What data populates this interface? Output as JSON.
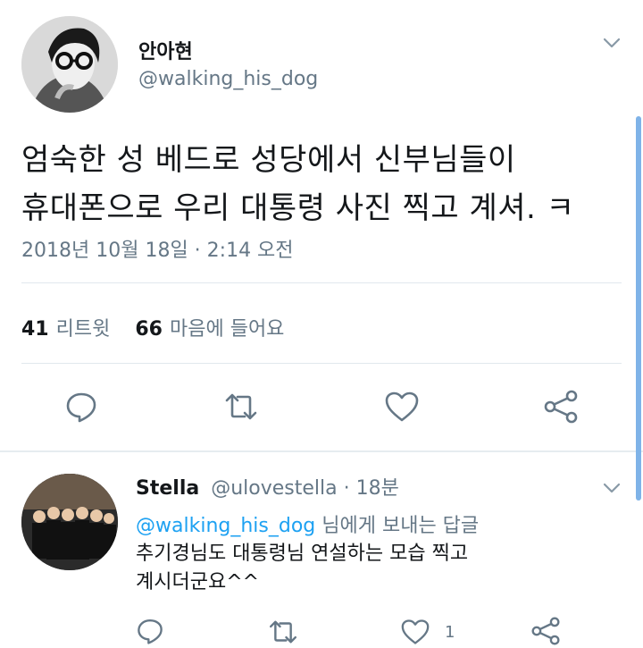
{
  "tweet": {
    "display_name": "안아현",
    "handle": "@walking_his_dog",
    "text_line1": "엄숙한 성 베드로 성당에서 신부님들이",
    "text_line2": "휴대폰으로 우리 대통령 사진 찍고 계셔. ㅋ",
    "timestamp": "2018년 10월 18일 · 2:14 오전",
    "retweet_count": "41",
    "retweet_label": "리트윗",
    "like_count": "66",
    "like_label": "마음에 들어요"
  },
  "reply": {
    "name": "Stella",
    "handle": "@ulovestella",
    "time": "· 18분",
    "reply_to_mention": "@walking_his_dog",
    "reply_to_suffix": " 님에게 보내는 답글",
    "text_line1": "추기경님도 대통령님 연설하는 모습 찍고",
    "text_line2": "계시더군요^^",
    "like_count": "1"
  },
  "colors": {
    "accent": "#1da1f2",
    "secondary_text": "#657786",
    "primary_text": "#14171a",
    "divider": "#e1e8ed"
  },
  "icons": [
    "chevron-down-icon",
    "reply-icon",
    "retweet-icon",
    "like-icon",
    "share-icon"
  ]
}
